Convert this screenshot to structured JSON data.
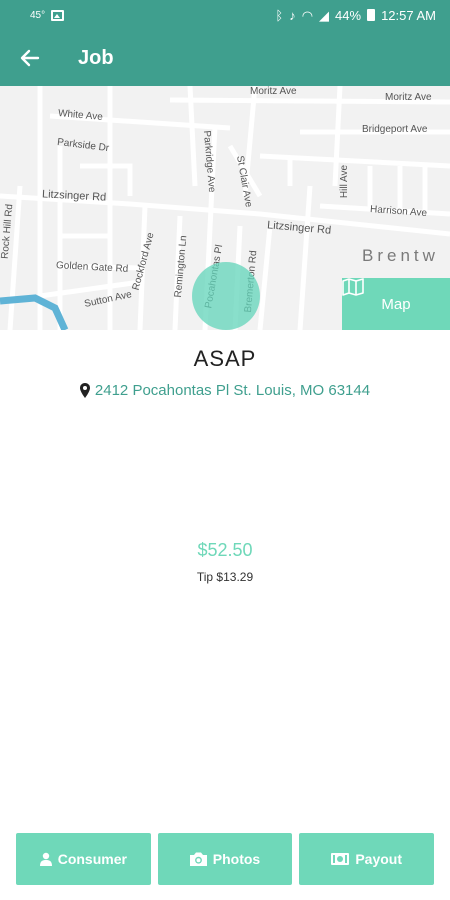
{
  "status_bar": {
    "temperature": "45°",
    "battery_percent": "44%",
    "time": "12:57 AM"
  },
  "app_bar": {
    "title": "Job"
  },
  "map": {
    "streets": [
      "Moritz Ave",
      "Moritz Ave",
      "White Ave",
      "Bridgeport Ave",
      "Parkside Dr",
      "Litzsinger Rd",
      "Litzsinger Rd",
      "Harrison Ave",
      "Golden Gate Rd",
      "Sutton Ave",
      "Rockford Ave",
      "Remington Ln",
      "Pocahontas Pl",
      "Bremerton Rd",
      "Parkridge Ave",
      "St Clair Ave",
      "Hill Ave",
      "Rock Hill Rd"
    ],
    "area_label": "Brentw",
    "map_button_label": "Map"
  },
  "job": {
    "when": "ASAP",
    "address": "2412 Pocahontas Pl St. Louis, MO 63144",
    "amount": "$52.50",
    "tip": "Tip $13.29"
  },
  "actions": {
    "consumer": "Consumer",
    "photos": "Photos",
    "payout": "Payout"
  },
  "colors": {
    "primary": "#3f9f8e",
    "accent": "#6fd8b9"
  }
}
